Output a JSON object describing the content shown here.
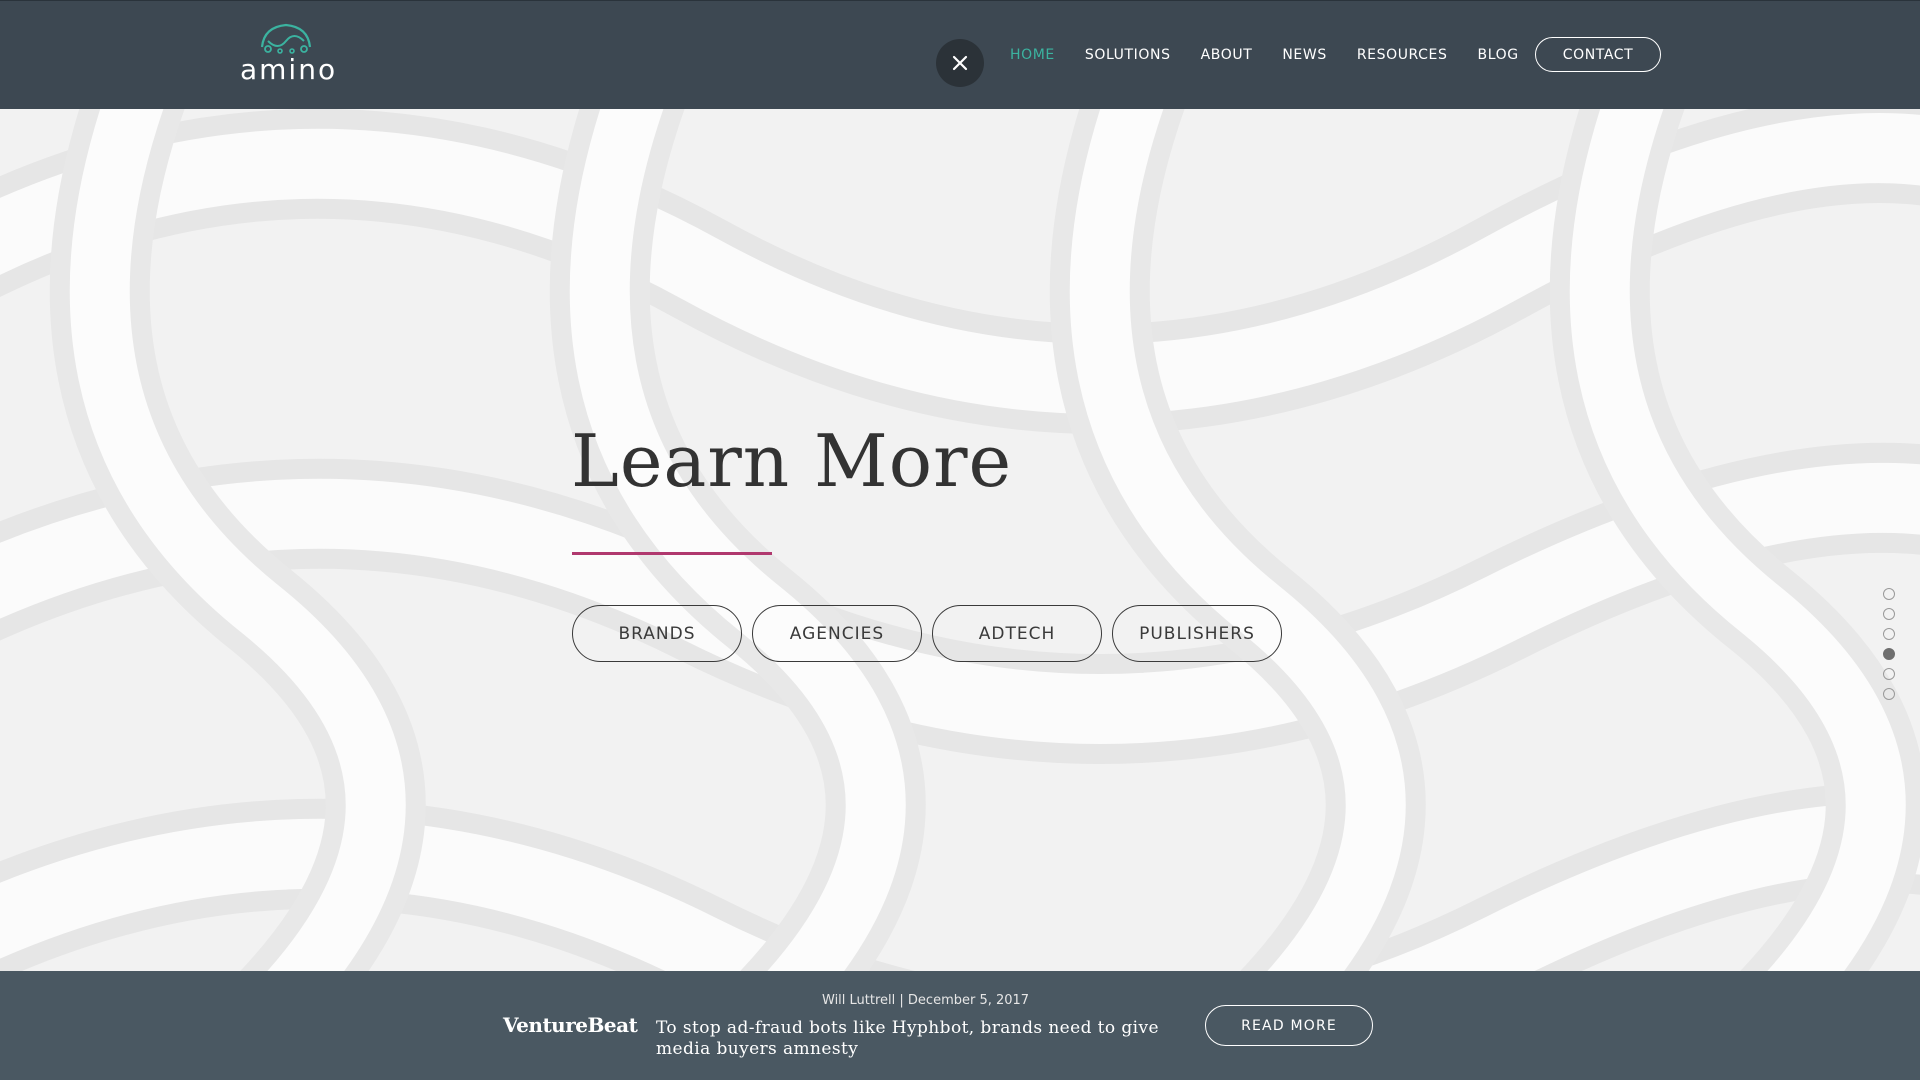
{
  "header": {
    "logo_text": "amino",
    "nav": [
      {
        "label": "HOME",
        "active": true
      },
      {
        "label": "SOLUTIONS",
        "active": false
      },
      {
        "label": "ABOUT",
        "active": false
      },
      {
        "label": "NEWS",
        "active": false
      },
      {
        "label": "RESOURCES",
        "active": false
      },
      {
        "label": "BLOG",
        "active": false
      }
    ],
    "contact_label": "CONTACT",
    "close_icon": "close-icon"
  },
  "hero": {
    "title": "Learn More",
    "pills": [
      "BRANDS",
      "AGENCIES",
      "ADTECH",
      "PUBLISHERS"
    ],
    "section_dots": {
      "count": 6,
      "active_index": 3
    }
  },
  "news": {
    "meta": "Will Luttrell | December 5, 2017",
    "source": "VentureBeat",
    "headline": "To stop ad-fraud bots like Hyphbot, brands need to give media buyers amnesty",
    "read_more_label": "READ MORE"
  },
  "colors": {
    "header_bg": "#3d4852",
    "accent_teal": "#3bb3a0",
    "accent_magenta": "#b0386e",
    "news_bg": "#4a5862"
  }
}
